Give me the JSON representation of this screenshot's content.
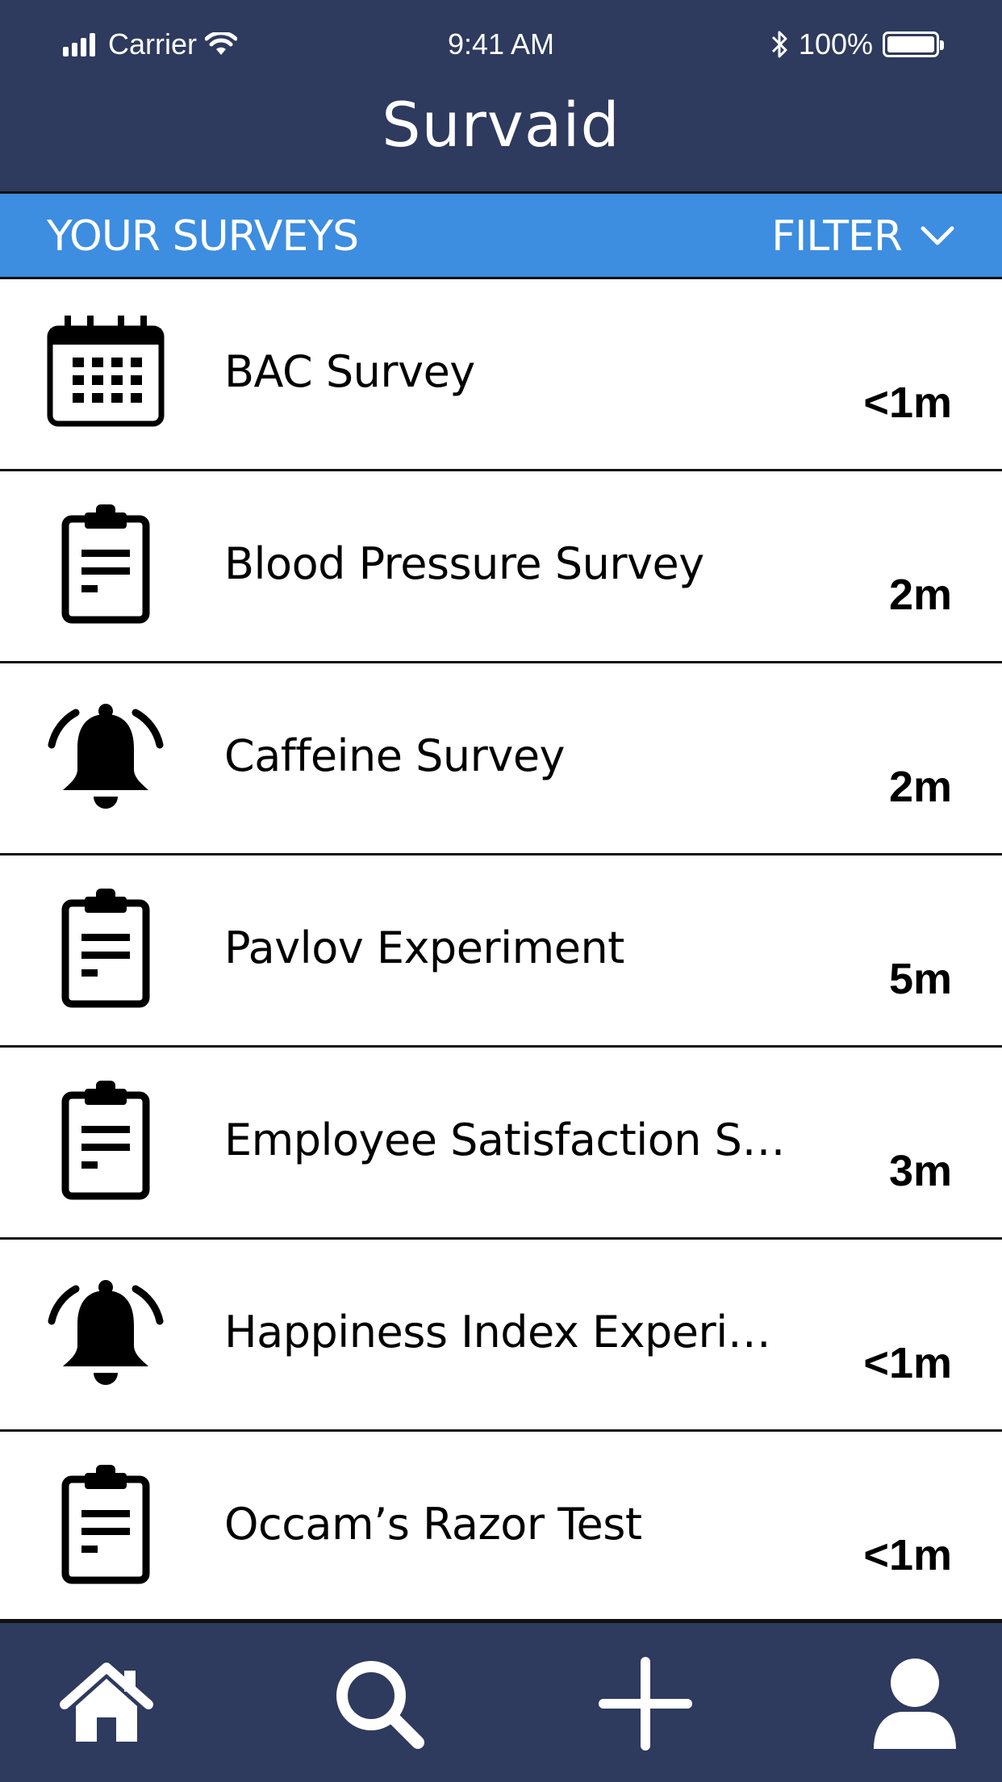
{
  "status_bar": {
    "carrier": "Carrier",
    "time": "9:41 AM",
    "battery": "100%"
  },
  "header": {
    "title": "Survaid"
  },
  "section": {
    "title": "YOUR SURVEYS",
    "filter_label": "FILTER"
  },
  "surveys": [
    {
      "title": "BAC Survey",
      "duration": "<1m",
      "icon": "calendar-icon"
    },
    {
      "title": "Blood Pressure Survey",
      "duration": "2m",
      "icon": "clipboard-icon"
    },
    {
      "title": "Caffeine Survey",
      "duration": "2m",
      "icon": "bell-ringing-icon"
    },
    {
      "title": "Pavlov Experiment",
      "duration": "5m",
      "icon": "clipboard-icon"
    },
    {
      "title": "Employee Satisfaction S…",
      "duration": "3m",
      "icon": "clipboard-icon"
    },
    {
      "title": "Happiness Index Experi…",
      "duration": "<1m",
      "icon": "bell-ringing-icon"
    },
    {
      "title": "Occam’s Razor Test",
      "duration": "<1m",
      "icon": "clipboard-icon"
    }
  ],
  "bottom_nav": [
    {
      "name": "home",
      "icon": "home-icon"
    },
    {
      "name": "search",
      "icon": "search-icon"
    },
    {
      "name": "add",
      "icon": "plus-icon"
    },
    {
      "name": "profile",
      "icon": "user-icon"
    }
  ],
  "colors": {
    "header_bg": "#2e3a5e",
    "accent": "#3d8de0",
    "text": "#000000"
  }
}
